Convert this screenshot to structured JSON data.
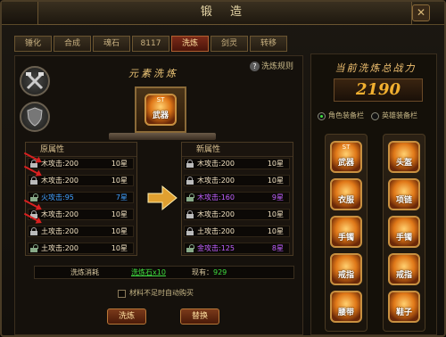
{
  "window": {
    "title": "锻 造",
    "close_label": "✕"
  },
  "tabs": [
    {
      "label": "锤化",
      "active": false
    },
    {
      "label": "合成",
      "active": false
    },
    {
      "label": "魂石",
      "active": false
    },
    {
      "label": "8117",
      "active": false
    },
    {
      "label": "洗炼",
      "active": true
    },
    {
      "label": "剑灵",
      "active": false
    },
    {
      "label": "转移",
      "active": false
    }
  ],
  "furnace": {
    "title": "元素洗炼",
    "rule_link": "洗炼规则",
    "rule_icon": "question-icon",
    "item": {
      "badge": "ST",
      "name": "武器"
    }
  },
  "side_icons": [
    "hammer-crossed-icon",
    "shield-icon"
  ],
  "old_attrs": {
    "header": "原属性",
    "rows": [
      {
        "name": "木攻击:200",
        "value": "10星",
        "locked": true,
        "color": "#f0e0c0"
      },
      {
        "name": "木攻击:200",
        "value": "10星",
        "locked": true,
        "color": "#f0e0c0"
      },
      {
        "name": "火攻击:95",
        "value": "7星",
        "locked": false,
        "color": "#40a0ff"
      },
      {
        "name": "木攻击:200",
        "value": "10星",
        "locked": true,
        "color": "#f0e0c0"
      },
      {
        "name": "土攻击:200",
        "value": "10星",
        "locked": true,
        "color": "#f0e0c0"
      },
      {
        "name": "土攻击:200",
        "value": "10星",
        "locked": false,
        "color": "#f0e0c0"
      }
    ]
  },
  "new_attrs": {
    "header": "新属性",
    "rows": [
      {
        "name": "木攻击:200",
        "value": "10星",
        "locked": true,
        "color": "#f0e0c0"
      },
      {
        "name": "木攻击:200",
        "value": "10星",
        "locked": true,
        "color": "#f0e0c0"
      },
      {
        "name": "木攻击:160",
        "value": "9星",
        "locked": false,
        "color": "#c060ff"
      },
      {
        "name": "木攻击:200",
        "value": "10星",
        "locked": true,
        "color": "#f0e0c0"
      },
      {
        "name": "土攻击:200",
        "value": "10星",
        "locked": true,
        "color": "#f0e0c0"
      },
      {
        "name": "金攻击:125",
        "value": "8星",
        "locked": false,
        "color": "#c060ff"
      }
    ]
  },
  "cost": {
    "label": "洗炼消耗",
    "item": "洗炼石x10",
    "owned_label": "现有：",
    "owned": "929"
  },
  "auto_buy": {
    "label": "材料不足时自动购买",
    "checked": false
  },
  "buttons": {
    "refine": "洗炼",
    "replace": "替换"
  },
  "power": {
    "title": "当前洗炼总战力",
    "value": "2190"
  },
  "equip_tabs": [
    {
      "label": "角色装备栏",
      "selected": true
    },
    {
      "label": "英雄装备栏",
      "selected": false
    }
  ],
  "equipment_left": [
    {
      "badge": "ST",
      "name": "武器"
    },
    {
      "badge": "",
      "name": "衣服"
    },
    {
      "badge": "",
      "name": "手镯"
    },
    {
      "badge": "",
      "name": "戒指"
    },
    {
      "badge": "",
      "name": "腰带"
    }
  ],
  "equipment_right": [
    {
      "badge": "",
      "name": "头盔"
    },
    {
      "badge": "",
      "name": "项链"
    },
    {
      "badge": "",
      "name": "手镯"
    },
    {
      "badge": "",
      "name": "戒指"
    },
    {
      "badge": "",
      "name": "鞋子"
    }
  ]
}
